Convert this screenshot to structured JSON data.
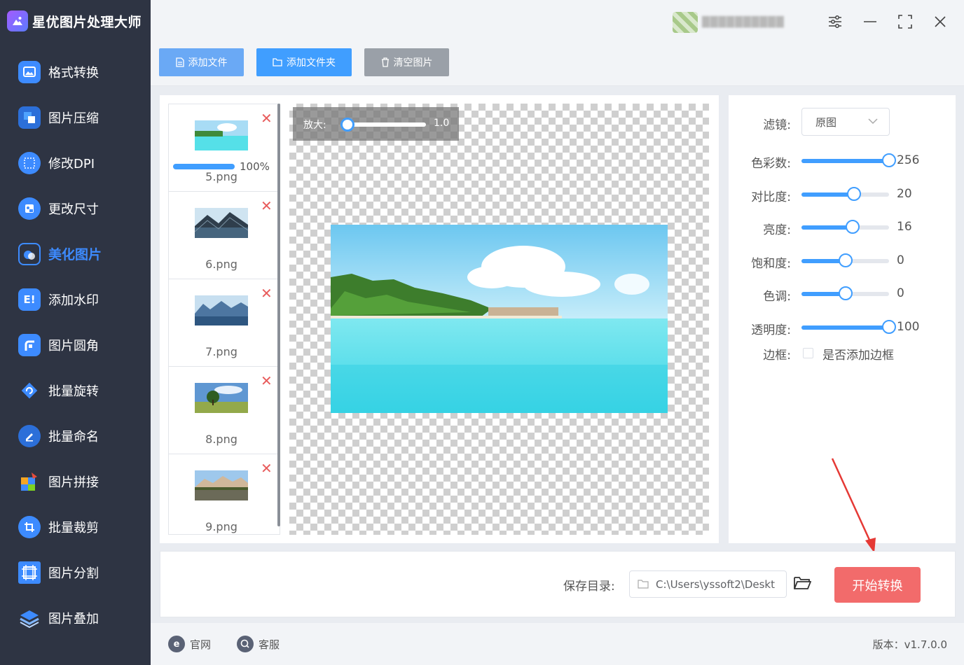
{
  "app": {
    "title": "星优图片处理大师"
  },
  "sidebar": {
    "items": [
      {
        "label": "格式转换",
        "icon": "image-convert-icon",
        "color": "#3d8bff"
      },
      {
        "label": "图片压缩",
        "icon": "compress-icon",
        "color": "#3d8bff"
      },
      {
        "label": "修改DPI",
        "icon": "dpi-icon",
        "color": "#3d8bff"
      },
      {
        "label": "更改尺寸",
        "icon": "resize-icon",
        "color": "#3d8bff"
      },
      {
        "label": "美化图片",
        "icon": "beautify-icon",
        "color": "#3d8bff",
        "active": true
      },
      {
        "label": "添加水印",
        "icon": "watermark-icon",
        "color": "#3d8bff"
      },
      {
        "label": "图片圆角",
        "icon": "rounded-corner-icon",
        "color": "#3d8bff"
      },
      {
        "label": "批量旋转",
        "icon": "rotate-icon",
        "color": "#3d8bff"
      },
      {
        "label": "批量命名",
        "icon": "rename-icon",
        "color": "#3d8bff"
      },
      {
        "label": "图片拼接",
        "icon": "puzzle-icon",
        "color": "#3d8bff"
      },
      {
        "label": "批量裁剪",
        "icon": "crop-icon",
        "color": "#3d8bff"
      },
      {
        "label": "图片分割",
        "icon": "split-icon",
        "color": "#3d8bff"
      },
      {
        "label": "图片叠加",
        "icon": "layers-icon",
        "color": "#3d8bff"
      }
    ]
  },
  "toolbar": {
    "add_file": "添加文件",
    "add_folder": "添加文件夹",
    "clear_images": "清空图片",
    "add_file_color": "#6aa9f5",
    "add_folder_color": "#409eff",
    "clear_color": "#9aa0a8"
  },
  "files": [
    {
      "name": "5.png",
      "progress": 100,
      "progress_text": "100%"
    },
    {
      "name": "6.png"
    },
    {
      "name": "7.png"
    },
    {
      "name": "8.png"
    },
    {
      "name": "9.png"
    }
  ],
  "preview": {
    "zoom_label": "放大:",
    "zoom_value": "1.0"
  },
  "settings": {
    "filter_label": "滤镜:",
    "filter_value": "原图",
    "color_count_label": "色彩数:",
    "color_count": 256,
    "contrast_label": "对比度:",
    "contrast": 20,
    "brightness_label": "亮度:",
    "brightness": 16,
    "saturation_label": "饱和度:",
    "saturation": 0,
    "hue_label": "色调:",
    "hue": 0,
    "opacity_label": "透明度:",
    "opacity": 100,
    "border_label": "边框:",
    "border_option": "是否添加边框",
    "border_checked": false
  },
  "bottom": {
    "save_dir_label": "保存目录:",
    "save_dir_value": "C:\\Users\\yssoft2\\Deskt",
    "start_button": "开始转换",
    "start_color": "#f26b6b"
  },
  "footer": {
    "website": "官网",
    "support": "客服",
    "version": "版本：v1.7.0.0"
  }
}
